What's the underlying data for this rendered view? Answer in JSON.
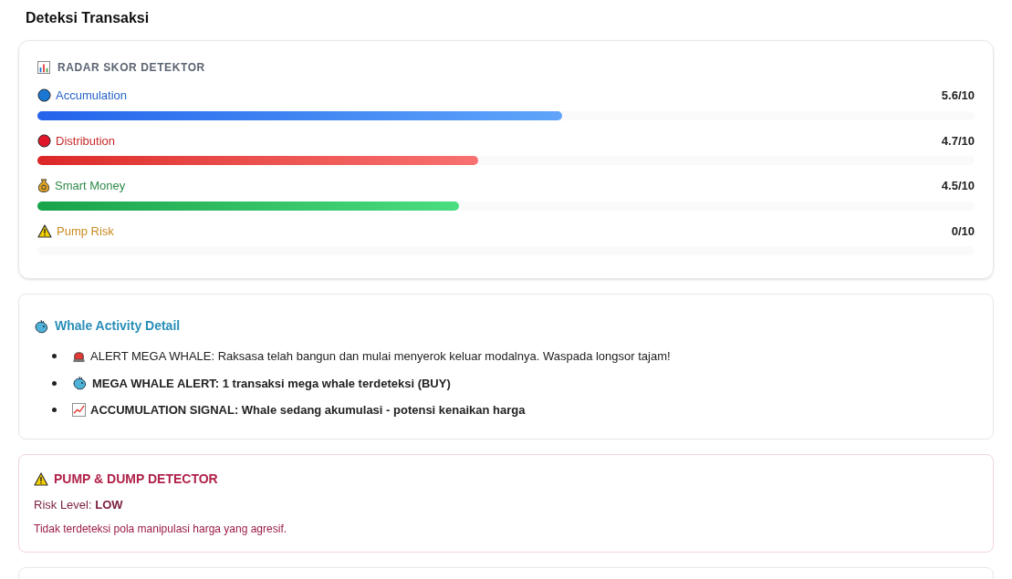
{
  "page_title": "Deteksi Transaksi",
  "radar": {
    "title": "RADAR SKOR DETEKTOR",
    "scores": [
      {
        "kind": "accumulation",
        "label": "Accumulation",
        "reading": "5.6/10",
        "level": 0.56
      },
      {
        "kind": "distribution",
        "label": "Distribution",
        "reading": "4.7/10",
        "level": 0.47
      },
      {
        "kind": "smart_money",
        "label": "Smart Money",
        "reading": "4.5/10",
        "level": 0.45
      },
      {
        "kind": "pump_risk",
        "label": "Pump Risk",
        "reading": "0/10",
        "level": 0
      }
    ]
  },
  "whale": {
    "title": "Whale Activity Detail",
    "items": [
      {
        "kind": "siren",
        "bold": false,
        "text": "ALERT MEGA WHALE: Raksasa telah bangun dan mulai menyerok keluar modalnya. Waspada longsor tajam!"
      },
      {
        "kind": "whale",
        "bold": true,
        "text": "MEGA WHALE ALERT: 1 transaksi mega whale terdeteksi (BUY)"
      },
      {
        "kind": "chart",
        "bold": true,
        "text": "ACCUMULATION SIGNAL: Whale sedang akumulasi - potensi kenaikan harga"
      }
    ]
  },
  "pump_dump": {
    "title": "PUMP & DUMP DETECTOR",
    "risk": "Risk Level: **LOW**",
    "message": "Tidak terdeteksi pola manipulasi harga yang agresif."
  }
}
